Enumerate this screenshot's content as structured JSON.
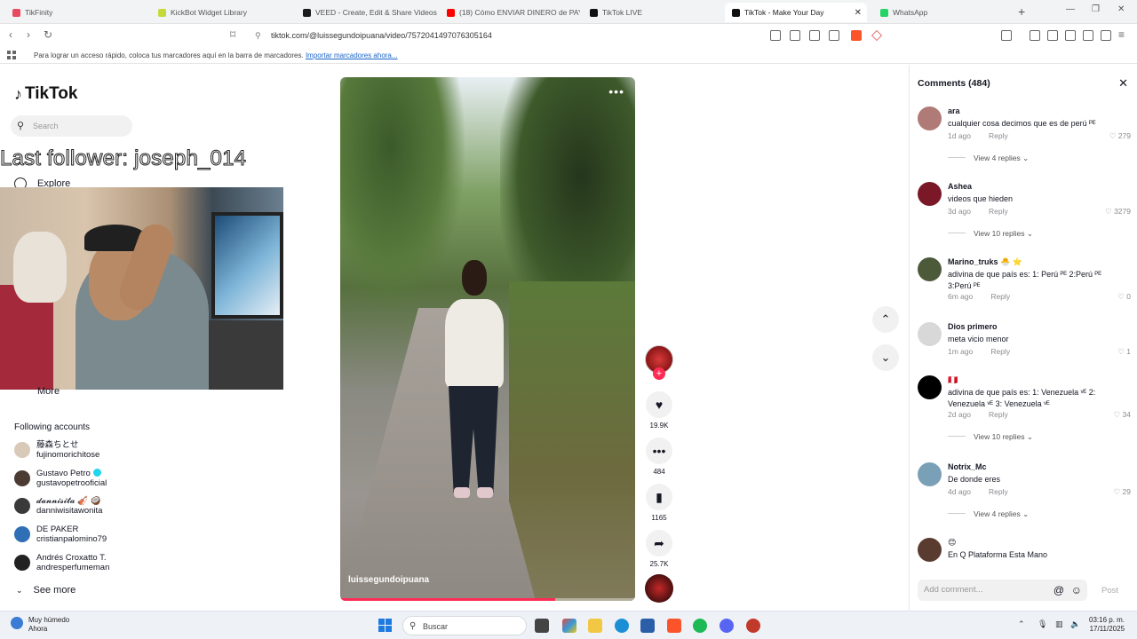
{
  "browser": {
    "tabs": [
      {
        "title": "TikFinity",
        "color": "#e84a5f",
        "active": false
      },
      {
        "title": "KickBot Widget Library",
        "color": "#c6d93b",
        "active": false
      },
      {
        "title": "VEED - Create, Edit & Share Videos O",
        "color": "#1b1b1b",
        "active": false
      },
      {
        "title": "(18) Cómo ENVIAR DINERO de PAYP",
        "color": "#ff0000",
        "active": false
      },
      {
        "title": "TikTok LIVE",
        "color": "#111111",
        "active": false
      },
      {
        "title": "TikTok - Make Your Day",
        "color": "#111111",
        "active": true
      },
      {
        "title": "WhatsApp",
        "color": "#25d366",
        "active": false
      }
    ],
    "url": "tiktok.com/@luissegundoipuana/video/7572041497076305164",
    "bookmarks_hint": "Para lograr un acceso rápido, coloca tus marcadores aquí en la barra de marcadores.",
    "bookmarks_link": "Importar marcadores ahora..."
  },
  "sidebar": {
    "logo": "TikTok",
    "search_placeholder": "Search",
    "overlay": "Last follower: joseph_014",
    "explore": "Explore",
    "more": "More",
    "following_title": "Following accounts",
    "accounts": [
      {
        "name": "藤森ちとせ",
        "username": "fujinomorichitose",
        "verified": false,
        "color": "#d9c9b8"
      },
      {
        "name": "Gustavo Petro",
        "username": "gustavopetrooficial",
        "verified": true,
        "color": "#4b3b33"
      },
      {
        "name": "𝓭𝓪𝓷𝓷𝓲𝓼𝓲𝓽𝓪 🎻 🥥",
        "username": "danniwisitawonita",
        "verified": false,
        "color": "#3a3a3a"
      },
      {
        "name": "DE PAKER",
        "username": "cristianpalomino79",
        "verified": false,
        "color": "#2e6fb5"
      },
      {
        "name": "Andrés Croxatto T.",
        "username": "andresperfumeman",
        "verified": false,
        "color": "#222222"
      }
    ],
    "see_more": "See more"
  },
  "video": {
    "author_handle": "luissegundoipuana",
    "progress": 0.73
  },
  "actions": {
    "likes": "19.9K",
    "comments": "484",
    "saves": "1165",
    "shares": "25.7K"
  },
  "comments": {
    "title": "Comments (484)",
    "items": [
      {
        "name": "ara",
        "text": "cualquier cosa decimos que es de perú ᴾᴱ",
        "time": "1d ago",
        "likes": "279",
        "replies": "View 4 replies",
        "color": "#b07a76"
      },
      {
        "name": "Ashea",
        "text": "videos que hieden",
        "time": "3d ago",
        "likes": "3279",
        "replies": "View 10 replies",
        "color": "#7a1828"
      },
      {
        "name": "Marino_truks 🐣 ⭐",
        "text": "adivina de que país es: 1: Perú ᴾᴱ 2:Perú ᴾᴱ 3:Perú ᴾᴱ",
        "time": "6m ago",
        "likes": "0",
        "replies": "",
        "color": "#4d5a3a"
      },
      {
        "name": "Dios primero",
        "text": "meta vicio menor",
        "time": "1m ago",
        "likes": "1",
        "replies": "",
        "color": "#d8d8d8"
      },
      {
        "name": "🇵🇪",
        "text": "adivina de que país es: 1: Venezuela ᵛᴱ 2: Venezuela ᵛᴱ 3: Venezuela ᵛᴱ",
        "time": "2d ago",
        "likes": "34",
        "replies": "View 10 replies",
        "color": "#000000"
      },
      {
        "name": "Notrix_Mc",
        "text": "De donde eres",
        "time": "4d ago",
        "likes": "29",
        "replies": "View 4 replies",
        "color": "#7aa0b8"
      },
      {
        "name": "😊",
        "text": "En Q Plataforma Esta Mano",
        "time": "",
        "likes": "",
        "replies": "",
        "color": "#5a3b30"
      }
    ],
    "reply_label": "Reply",
    "add_placeholder": "Add comment...",
    "post_label": "Post"
  },
  "taskbar": {
    "weather_title": "Muy húmedo",
    "weather_sub": "Ahora",
    "search_placeholder": "Buscar",
    "time": "03:16 p. m.",
    "date": "17/11/2025"
  }
}
